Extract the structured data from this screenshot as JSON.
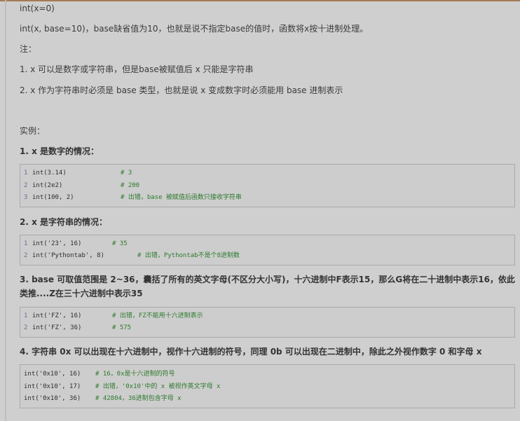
{
  "intro": {
    "line1": "int(x=0)",
    "line2": "int(x, base=10)，base缺省值为10，也就是说不指定base的值时，函数将x按十进制处理。",
    "note_label": "注：",
    "note1": "1. x 可以是数字或字符串，但是base被赋值后 x 只能是字符串",
    "note2": "2. x 作为字符串时必须是 base 类型，也就是说 x 变成数字时必须能用 base 进制表示",
    "example_label": "实例："
  },
  "sections": [
    {
      "heading": "1. x 是数字的情况：",
      "lines": [
        {
          "num": "1",
          "code": "int(3.14)",
          "comment": "# 3"
        },
        {
          "num": "2",
          "code": "int(2e2)",
          "comment": "# 200"
        },
        {
          "num": "3",
          "code": "int(100, 2)",
          "comment": "# 出错，base 被赋值后函数只接收字符串"
        }
      ]
    },
    {
      "heading": "2. x 是字符串的情况：",
      "lines": [
        {
          "num": "1",
          "code": "int('23', 16)",
          "comment": "# 35"
        },
        {
          "num": "2",
          "code": "int('Pythontab', 8)",
          "comment": "# 出错，Pythontab不是个8进制数"
        }
      ]
    },
    {
      "heading": "3. base 可取值范围是 2~36，囊括了所有的英文字母(不区分大小写)，十六进制中F表示15，那么G将在二十进制中表示16，依此类推....Z在三十六进制中表示35",
      "lines": [
        {
          "num": "1",
          "code": "int('FZ', 16)",
          "comment": "# 出错，FZ不能用十六进制表示"
        },
        {
          "num": "2",
          "code": "int('FZ', 36)",
          "comment": "# 575"
        }
      ]
    },
    {
      "heading": "4. 字符串 0x 可以出现在十六进制中，视作十六进制的符号，同理 0b 可以出现在二进制中，除此之外视作数字 0 和字母 x",
      "lines": [
        {
          "num": "",
          "code": "int('0x10', 16)",
          "comment": "# 16，0x是十六进制的符号"
        },
        {
          "num": "",
          "code": "int('0x10', 17)",
          "comment": "# 出错，'0x10'中的 x 被视作英文字母 x"
        },
        {
          "num": "",
          "code": "int('0x10', 36)",
          "comment": "# 42804，36进制包含字母 x"
        }
      ]
    }
  ]
}
